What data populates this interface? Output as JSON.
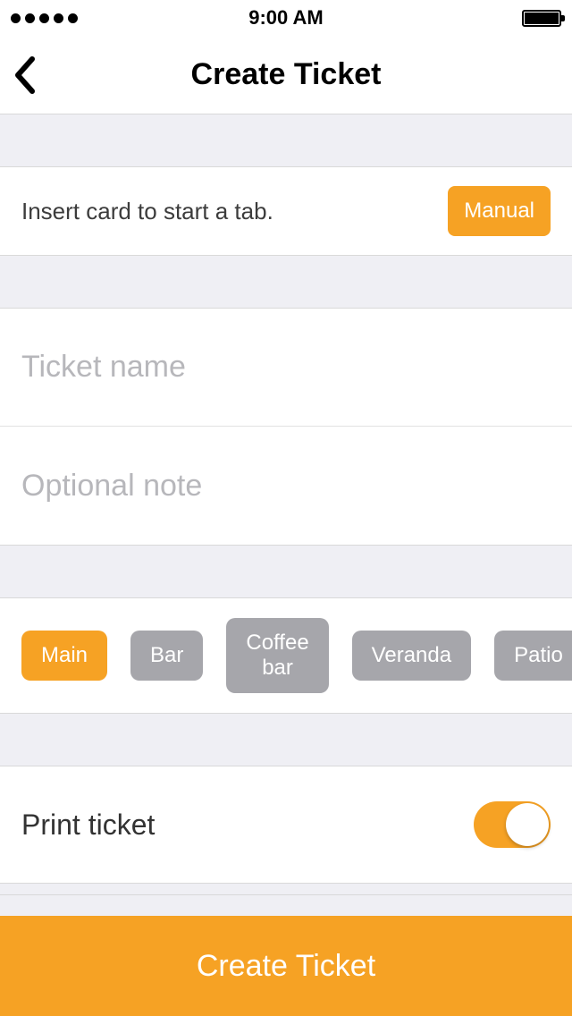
{
  "status": {
    "time": "9:00 AM"
  },
  "nav": {
    "title": "Create Ticket"
  },
  "insert": {
    "text": "Insert card to start a tab.",
    "manual_label": "Manual"
  },
  "inputs": {
    "ticket_name_placeholder": "Ticket name",
    "ticket_name_value": "",
    "note_placeholder": "Optional note",
    "note_value": ""
  },
  "areas": {
    "items": [
      {
        "label": "Main",
        "selected": true
      },
      {
        "label": "Bar",
        "selected": false
      },
      {
        "label": "Coffee bar",
        "selected": false
      },
      {
        "label": "Veranda",
        "selected": false
      },
      {
        "label": "Patio",
        "selected": false
      }
    ]
  },
  "print": {
    "label": "Print ticket",
    "on": true
  },
  "footer": {
    "create_label": "Create Ticket"
  },
  "colors": {
    "accent": "#f6a224",
    "chip_inactive": "#a6a6ab",
    "page_bg": "#efeff4"
  }
}
